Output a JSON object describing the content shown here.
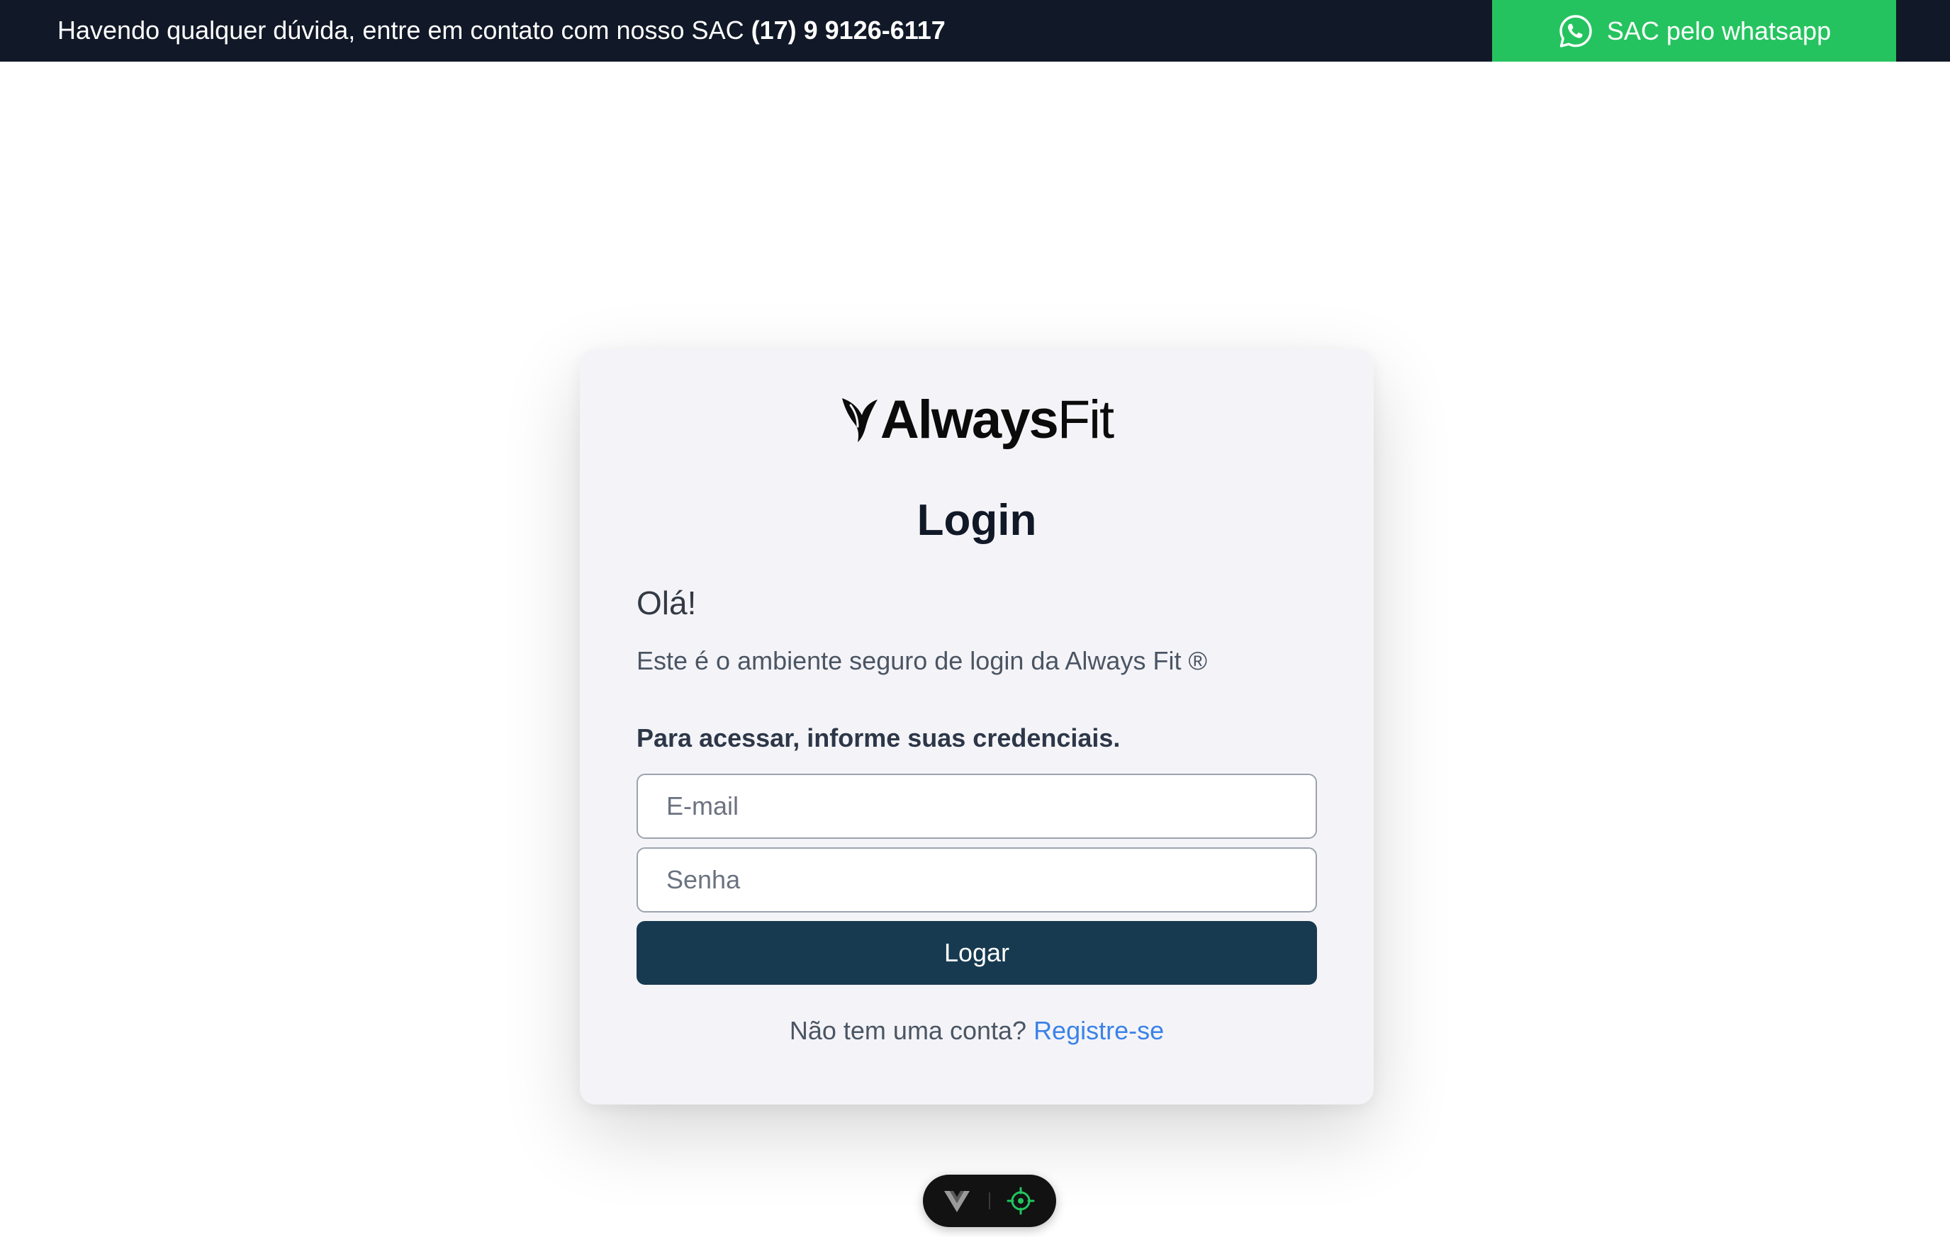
{
  "topbar": {
    "message": "Havendo qualquer dúvida, entre em contato com nosso SAC ",
    "phone": "(17) 9 9126-6117",
    "whatsapp_label": "SAC pelo whatsapp",
    "background_color": "#111827",
    "whatsapp_color": "#25c35f"
  },
  "logo": {
    "bold": "Always",
    "light": "Fit",
    "icon": "leaf-mark-icon"
  },
  "login": {
    "title": "Login",
    "greeting": "Olá!",
    "intro": "Este é o ambiente seguro de login da Always Fit ®",
    "credentials_label": "Para acessar, informe suas credenciais.",
    "email_placeholder": "E-mail",
    "email_value": "",
    "password_placeholder": "Senha",
    "password_value": "",
    "submit_label": "Logar",
    "submit_color": "#173a50",
    "register_prompt": "Não tem uma conta?",
    "register_link": "Registre-se",
    "link_color": "#3b82e8"
  },
  "devtools": {
    "icons": [
      "vue-logo-icon",
      "target-icon"
    ]
  }
}
